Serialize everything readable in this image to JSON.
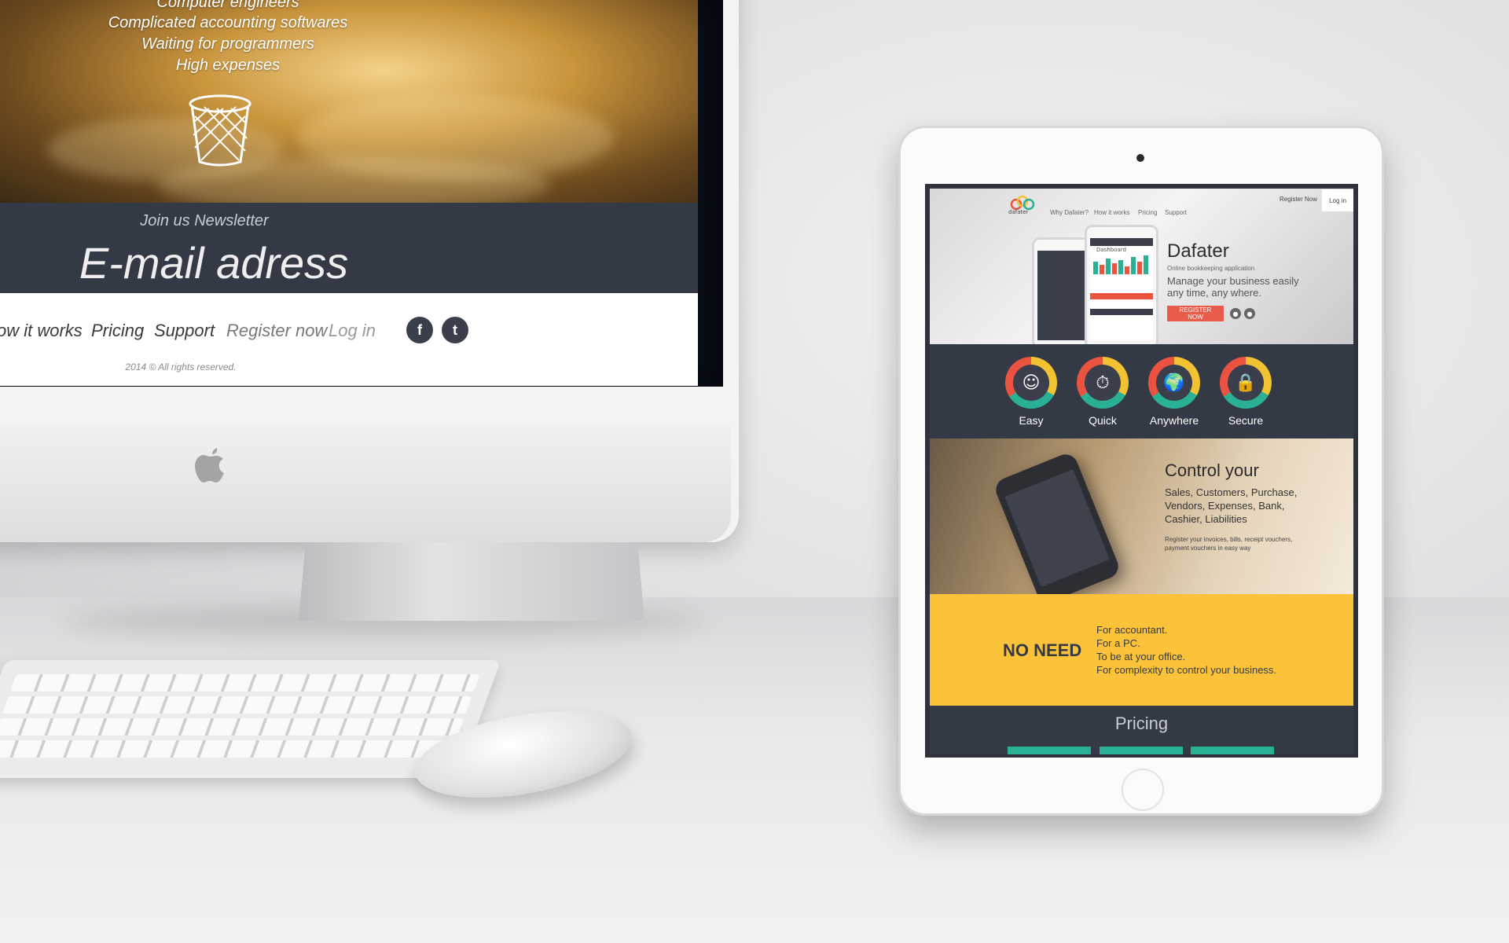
{
  "imac": {
    "hero_lines": [
      "Computer engineers",
      "Complicated accounting softwares",
      "Waiting for programmers",
      "High expenses"
    ],
    "trash_icon": "trash-basket-icon",
    "newsletter_title": "Join us Newsletter",
    "email_placeholder": "E-mail adress",
    "footer_links": [
      "ow it works",
      "Pricing",
      "Support",
      "Register now",
      "Log in"
    ],
    "social": {
      "facebook": "f",
      "twitter": "t"
    },
    "copyright": "2014 © All rights reserved."
  },
  "ipad": {
    "logo_text": "dafater",
    "nav": [
      "Why Dafater?",
      "How it works",
      "Pricing",
      "Support"
    ],
    "register": "Register Now",
    "login": "Log in",
    "dashboard_title": "Dashboard",
    "app_name": "Dafater",
    "app_sub": "Online bookkeeping application",
    "app_desc": "Manage your business easily any time, any where.",
    "register_btn": "REGISTER NOW",
    "features": [
      {
        "label": "Easy",
        "icon": "☺"
      },
      {
        "label": "Quick",
        "icon": "⏱"
      },
      {
        "label": "Anywhere",
        "icon": "🌍"
      },
      {
        "label": "Secure",
        "icon": "🔒"
      }
    ],
    "control_title": "Control your",
    "control_list": "Sales, Customers, Purchase, Vendors, Expenses, Bank, Cashier, Liabilities",
    "control_note": "Register your invoices, bills, receipt vouchers, payment vouchers in easy way",
    "noneed_title": "NO NEED",
    "noneed_list": [
      "For accountant.",
      "For a PC.",
      "To be at your office.",
      "For complexity to control your business."
    ],
    "pricing_title": "Pricing"
  },
  "colors": {
    "dark": "#343946",
    "yellow": "#fcc33a",
    "red": "#e95b4b",
    "green": "#2ab193"
  }
}
